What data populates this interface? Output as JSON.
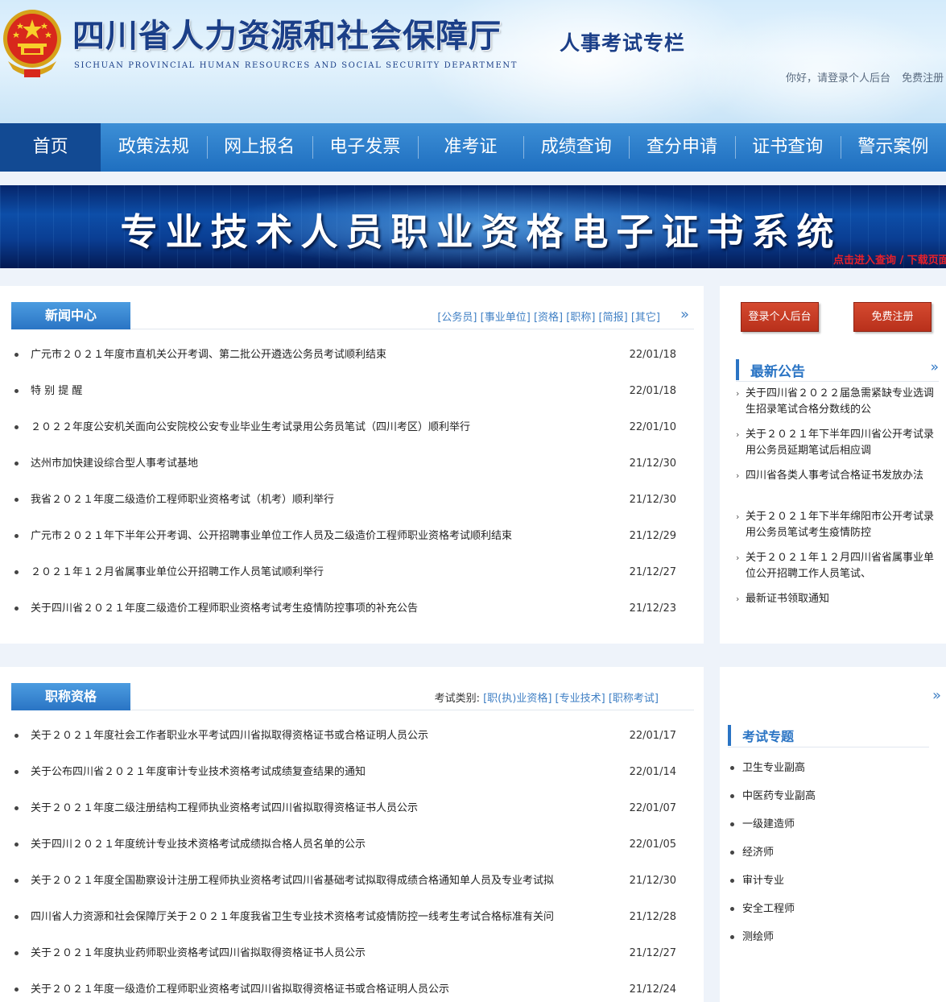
{
  "header": {
    "site_title": "四川省人力资源和社会保障厅",
    "site_subtitle": "SICHUAN PROVINCIAL HUMAN RESOURCES AND SOCIAL SECURITY DEPARTMENT",
    "column_title": "人事考试专栏",
    "login_prompt": "你好，请登录个人后台",
    "register_link": "免费注册"
  },
  "nav": {
    "items": [
      "首页",
      "政策法规",
      "网上报名",
      "电子发票",
      "准考证",
      "成绩查询",
      "查分申请",
      "证书查询",
      "警示案例"
    ],
    "active_index": 0
  },
  "banner": {
    "title": "专业技术人员职业资格电子证书系统",
    "link": "点击进入查询 / 下载页面"
  },
  "news": {
    "heading": "新闻中心",
    "categories": [
      "[公务员]",
      "[事业单位]",
      "[资格]",
      "[职称]",
      "[简报]",
      "[其它]"
    ],
    "more_icon": "double-chevron-right",
    "items": [
      {
        "title": "广元市２０２１年度市直机关公开考调、第二批公开遴选公务员考试顺利结束",
        "date": "22/01/18"
      },
      {
        "title": "特 别 提 醒",
        "date": "22/01/18"
      },
      {
        "title": "２０２２年度公安机关面向公安院校公安专业毕业生考试录用公务员笔试（四川考区）顺利举行",
        "date": "22/01/10"
      },
      {
        "title": "达州市加快建设综合型人事考试基地",
        "date": "21/12/30"
      },
      {
        "title": "我省２０２１年度二级造价工程师职业资格考试（机考）顺利举行",
        "date": "21/12/30"
      },
      {
        "title": "广元市２０２１年下半年公开考调、公开招聘事业单位工作人员及二级造价工程师职业资格考试顺利结束",
        "date": "21/12/29"
      },
      {
        "title": "２０２１年１２月省属事业单位公开招聘工作人员笔试顺利举行",
        "date": "21/12/27"
      },
      {
        "title": "关于四川省２０２１年度二级造价工程师职业资格考试考生疫情防控事项的补充公告",
        "date": "21/12/23"
      }
    ]
  },
  "side": {
    "login_button": "登录个人后台",
    "register_button": "免费注册",
    "notice_heading": "最新公告",
    "notices": [
      "关于四川省２０２２届急需紧缺专业选调生招录笔试合格分数线的公",
      "关于２０２１年下半年四川省公开考试录用公务员延期笔试后相应调",
      "四川省各类人事考试合格证书发放办法",
      "关于２０２１年下半年绵阳市公开考试录用公务员笔试考生疫情防控",
      "关于２０２１年１２月四川省省属事业单位公开招聘工作人员笔试、",
      "最新证书领取通知"
    ]
  },
  "titles": {
    "heading": "职称资格",
    "category_label": "考试类别:",
    "categories": [
      "[职(执)业资格]",
      "[专业技术]",
      "[职称考试]"
    ],
    "items": [
      {
        "title": "关于２０２１年度社会工作者职业水平考试四川省拟取得资格证书或合格证明人员公示",
        "date": "22/01/17"
      },
      {
        "title": "关于公布四川省２０２１年度审计专业技术资格考试成绩复查结果的通知",
        "date": "22/01/14"
      },
      {
        "title": "关于２０２１年度二级注册结构工程师执业资格考试四川省拟取得资格证书人员公示",
        "date": "22/01/07"
      },
      {
        "title": "关于四川２０２１年度统计专业技术资格考试成绩拟合格人员名单的公示",
        "date": "22/01/05"
      },
      {
        "title": "关于２０２１年度全国勘察设计注册工程师执业资格考试四川省基础考试拟取得成绩合格通知单人员及专业考试拟",
        "date": "21/12/30"
      },
      {
        "title": "四川省人力资源和社会保障厅关于２０２１年度我省卫生专业技术资格考试疫情防控一线考生考试合格标准有关问",
        "date": "21/12/28"
      },
      {
        "title": "关于２０２１年度执业药师职业资格考试四川省拟取得资格证书人员公示",
        "date": "21/12/27"
      },
      {
        "title": "关于２０２１年度一级造价工程师职业资格考试四川省拟取得资格证书或合格证明人员公示",
        "date": "21/12/24"
      }
    ]
  },
  "topics": {
    "heading": "考试专题",
    "items": [
      "卫生专业副高",
      "中医药专业副高",
      "一级建造师",
      "经济师",
      "审计专业",
      "安全工程师",
      "测绘师"
    ]
  },
  "colors": {
    "brand_blue": "#1b3f88",
    "nav_blue": "#2a7bcc",
    "nav_active": "#124a93",
    "accent_red": "#c0392b",
    "link_blue": "#3f7fc4"
  }
}
